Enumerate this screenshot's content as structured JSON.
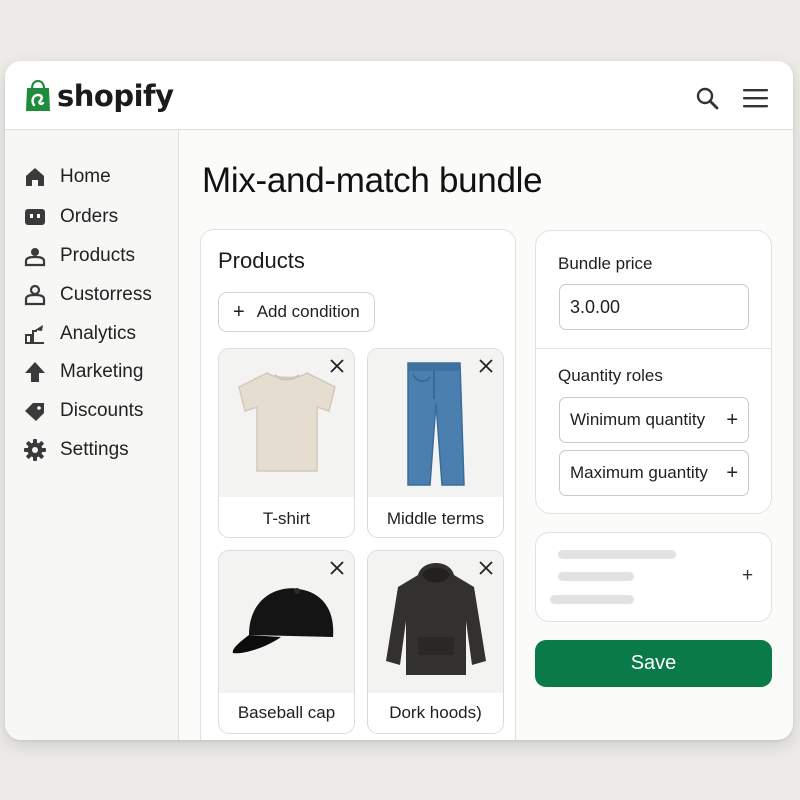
{
  "brand": {
    "logo_text": "shopify",
    "accent": "#0b7a49",
    "logo_green": "#1f8b3c"
  },
  "header": {
    "icons": [
      "search-icon",
      "menu-icon"
    ]
  },
  "sidebar": {
    "items": [
      {
        "label": "Home",
        "icon": "home-icon"
      },
      {
        "label": "Orders",
        "icon": "orders-icon"
      },
      {
        "label": "Products",
        "icon": "products-icon"
      },
      {
        "label": "Custorress",
        "icon": "customers-icon"
      },
      {
        "label": "Analytics",
        "icon": "analytics-icon"
      },
      {
        "label": "Marketing",
        "icon": "marketing-icon"
      },
      {
        "label": "Discounts",
        "icon": "discounts-icon"
      },
      {
        "label": "Settings",
        "icon": "gear-icon"
      }
    ]
  },
  "main": {
    "title": "Mix-and-match bundle",
    "products": {
      "heading": "Products",
      "add_condition_label": "Add condition",
      "items": [
        {
          "label": "T-shirt",
          "image": "tshirt-image"
        },
        {
          "label": "Middle terms",
          "image": "jeans-image"
        },
        {
          "label": "Baseball cap",
          "image": "cap-image"
        },
        {
          "label": "Dork hoods)",
          "image": "hoodie-image"
        }
      ]
    },
    "bundle": {
      "price_label": "Bundle price",
      "price_value": "3.0.00",
      "quantity_heading": "Quantity roles",
      "min_label": "Winimum quantity",
      "max_label": "Maximum guantity"
    },
    "save_label": "Save"
  }
}
